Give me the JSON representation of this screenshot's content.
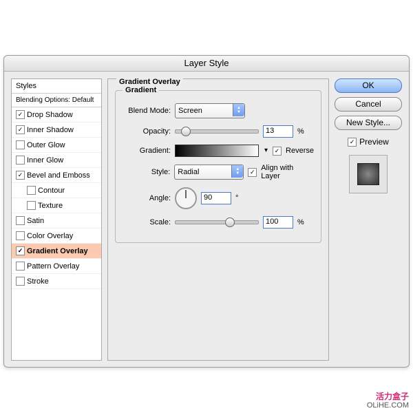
{
  "dialog": {
    "title": "Layer Style"
  },
  "sidebar": {
    "header": "Styles",
    "subheader": "Blending Options: Default",
    "items": [
      {
        "label": "Drop Shadow",
        "checked": true,
        "indent": false
      },
      {
        "label": "Inner Shadow",
        "checked": true,
        "indent": false
      },
      {
        "label": "Outer Glow",
        "checked": false,
        "indent": false
      },
      {
        "label": "Inner Glow",
        "checked": false,
        "indent": false
      },
      {
        "label": "Bevel and Emboss",
        "checked": true,
        "indent": false
      },
      {
        "label": "Contour",
        "checked": false,
        "indent": true
      },
      {
        "label": "Texture",
        "checked": false,
        "indent": true
      },
      {
        "label": "Satin",
        "checked": false,
        "indent": false
      },
      {
        "label": "Color Overlay",
        "checked": false,
        "indent": false
      },
      {
        "label": "Gradient Overlay",
        "checked": true,
        "indent": false,
        "selected": true
      },
      {
        "label": "Pattern Overlay",
        "checked": false,
        "indent": false
      },
      {
        "label": "Stroke",
        "checked": false,
        "indent": false
      }
    ]
  },
  "main": {
    "title": "Gradient Overlay",
    "group": "Gradient",
    "blend_mode_label": "Blend Mode:",
    "blend_mode_value": "Screen",
    "opacity_label": "Opacity:",
    "opacity_value": "13",
    "pct": "%",
    "gradient_label": "Gradient:",
    "reverse_label": "Reverse",
    "reverse_checked": true,
    "style_label": "Style:",
    "style_value": "Radial",
    "align_label": "Align with Layer",
    "align_checked": true,
    "angle_label": "Angle:",
    "angle_value": "90",
    "angle_deg": "°",
    "scale_label": "Scale:",
    "scale_value": "100"
  },
  "right": {
    "ok": "OK",
    "cancel": "Cancel",
    "newstyle": "New Style...",
    "preview": "Preview",
    "preview_checked": true
  },
  "watermark": {
    "cn": "活力盒子",
    "en": "OLiHE.COM"
  }
}
